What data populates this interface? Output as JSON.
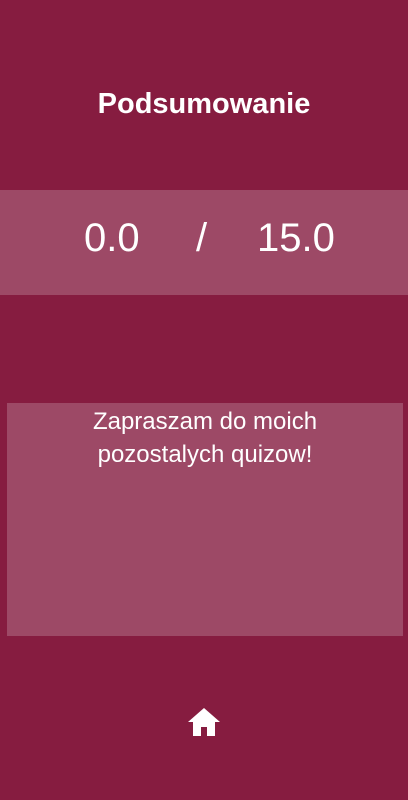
{
  "summary": {
    "title": "Podsumowanie"
  },
  "score": {
    "current": "0.0",
    "separator": "/",
    "max": "15.0"
  },
  "message": {
    "text": "Zapraszam do moich pozostalych quizow!"
  },
  "navigation": {
    "home_icon": "home-icon"
  },
  "colors": {
    "background": "#861c40",
    "panel": "#9d4966",
    "text": "#ffffff"
  }
}
